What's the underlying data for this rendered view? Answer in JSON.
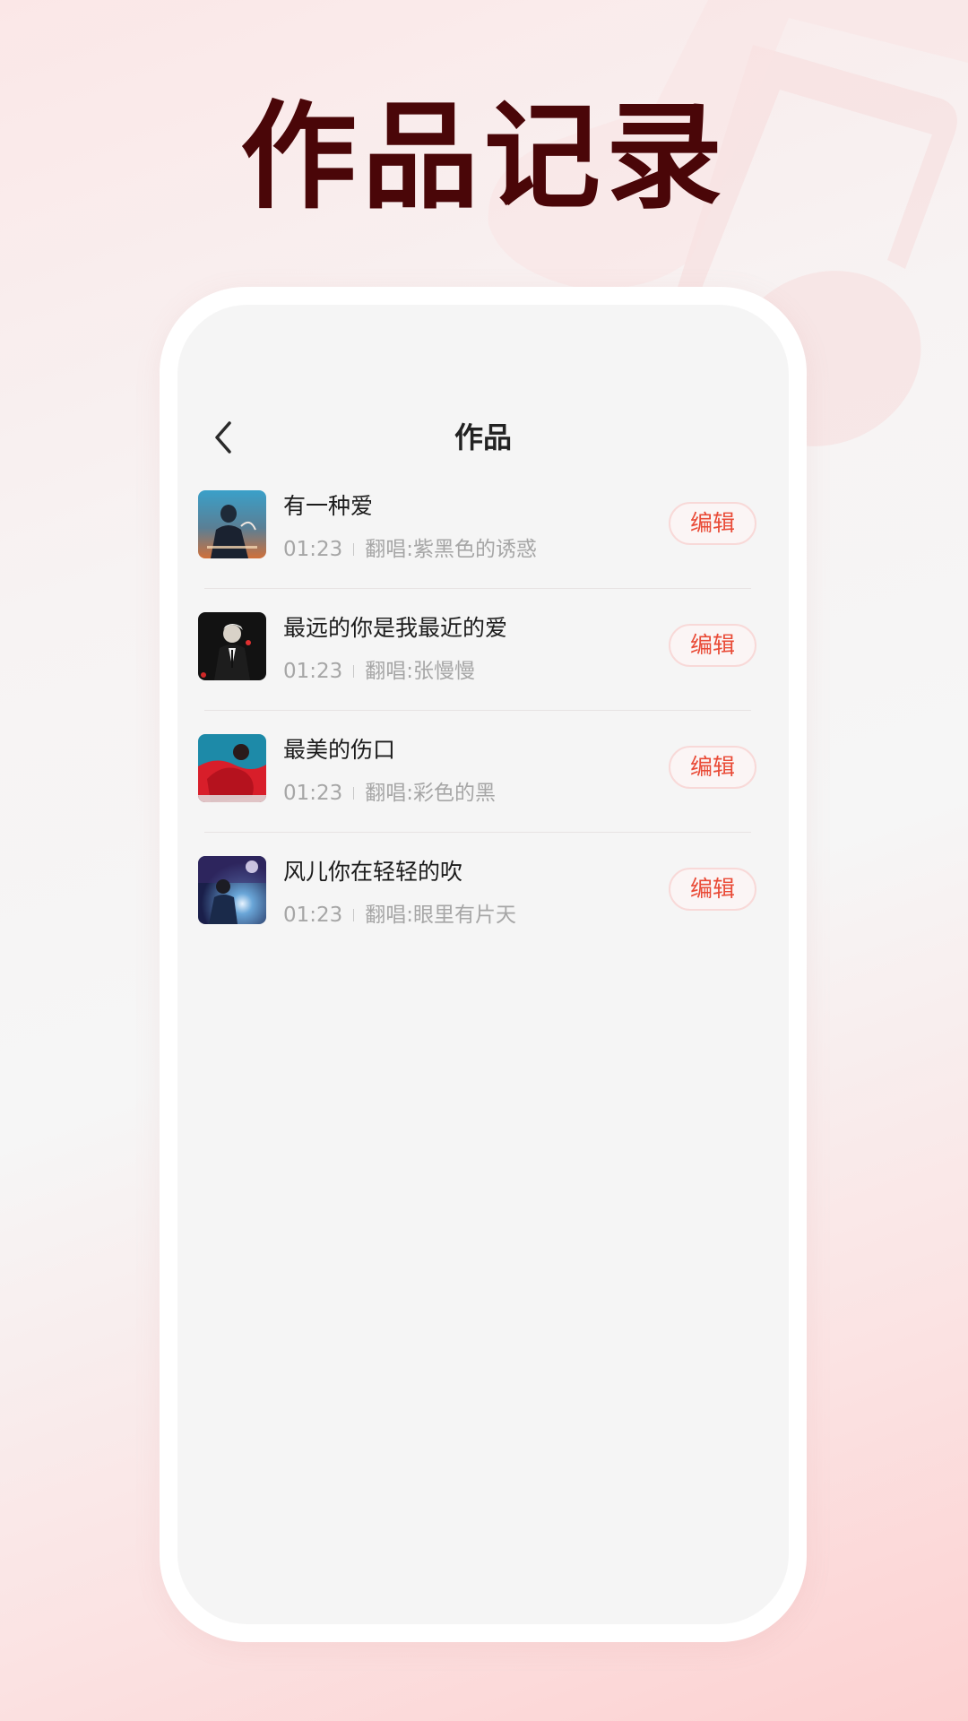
{
  "headline": "作品记录",
  "navbar": {
    "title": "作品"
  },
  "songs": [
    {
      "title": "有一种爱",
      "duration": "01:23",
      "cover_artist": "翻唱:紫黑色的诱惑",
      "edit_label": "编辑"
    },
    {
      "title": "最远的你是我最近的爱",
      "duration": "01:23",
      "cover_artist": "翻唱:张慢慢",
      "edit_label": "编辑"
    },
    {
      "title": "最美的伤口",
      "duration": "01:23",
      "cover_artist": "翻唱:彩色的黑",
      "edit_label": "编辑"
    },
    {
      "title": "风儿你在轻轻的吹",
      "duration": "01:23",
      "cover_artist": "翻唱:眼里有片天",
      "edit_label": "编辑"
    }
  ],
  "colors": {
    "headline": "#4a0608",
    "accent": "#e94a36",
    "screen_bg": "#f5f5f5"
  },
  "icons": {
    "back": "chevron-left-icon",
    "background": "music-note-icon"
  }
}
